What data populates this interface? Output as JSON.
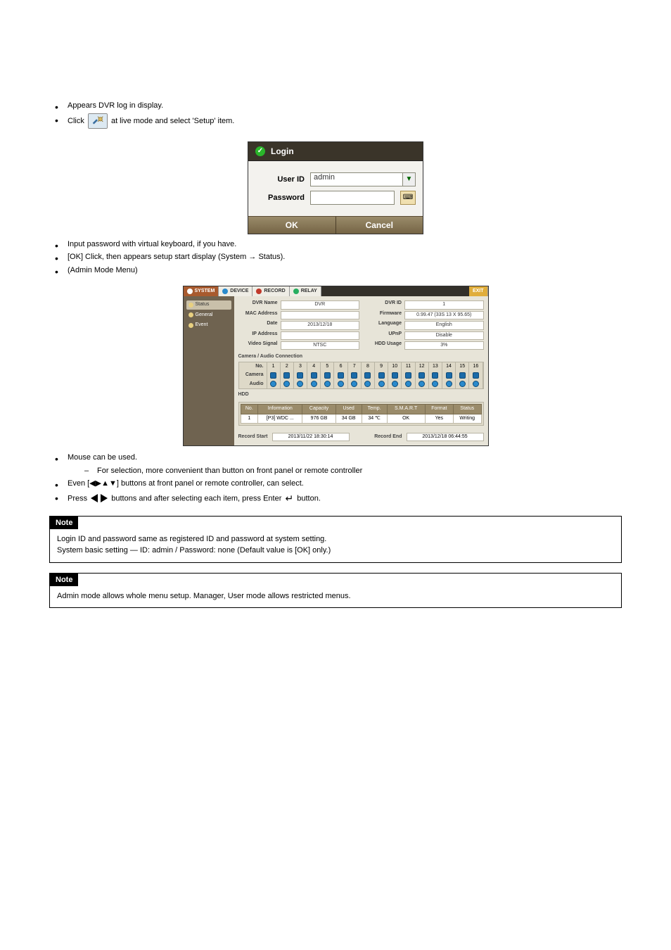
{
  "intro": {
    "line1": "Appears DVR log in display.",
    "line2_prefix": "Click ",
    "line2_suffix": " at live mode and select 'Setup' item."
  },
  "login_dialog": {
    "title": "Login",
    "user_label": "User ID",
    "user_value": "admin",
    "pass_label": "Password",
    "pass_value": "",
    "ok": "OK",
    "cancel": "Cancel"
  },
  "post_login": {
    "b1": "Input password with virtual keyboard, if you have.",
    "b2": "[OK] Click, then appears setup start display (System → Status).",
    "b3": "(Admin Mode Menu)"
  },
  "system_panel": {
    "tabs": {
      "system": "SYSTEM",
      "device": "DEVICE",
      "record": "RECORD",
      "relay": "RELAY",
      "exit": "EXIT"
    },
    "sidebar": [
      {
        "label": "Status",
        "active": true
      },
      {
        "label": "General",
        "active": false
      },
      {
        "label": "Event",
        "active": false
      }
    ],
    "info": {
      "dvr_name_label": "DVR Name",
      "dvr_name": "DVR",
      "dvr_id_label": "DVR ID",
      "dvr_id": "1",
      "mac_label": "MAC Address",
      "mac": "",
      "firmware_label": "Firmware",
      "firmware": "0.99.47 (33S 13 X 95.65)",
      "date_label": "Date",
      "date": "2013/12/18",
      "language_label": "Language",
      "language": "English",
      "ip_label": "IP Address",
      "ip": "",
      "upnp_label": "UPnP",
      "upnp": "Disable",
      "video_label": "Video Signal",
      "video": "NTSC",
      "hddusage_label": "HDD Usage",
      "hddusage": "3%"
    },
    "cam_section_title": "Camera / Audio Connection",
    "cam_labels": {
      "no": "No.",
      "camera": "Camera",
      "audio": "Audio"
    },
    "cam_numbers": [
      "1",
      "2",
      "3",
      "4",
      "5",
      "6",
      "7",
      "8",
      "9",
      "10",
      "11",
      "12",
      "13",
      "14",
      "15",
      "16"
    ],
    "hdd_title": "HDD",
    "hdd_headers": [
      "No.",
      "Information",
      "Capacity",
      "Used",
      "Temp.",
      "S.M.A.R.T",
      "Format",
      "Status"
    ],
    "hdd_row": [
      "1",
      "[P3] WDC ...",
      "976 GB",
      "34 GB",
      "34 ℃",
      "OK",
      "Yes",
      "Writing"
    ],
    "record_start_label": "Record Start",
    "record_start": "2013/11/22 18:30:14",
    "record_end_label": "Record End",
    "record_end": "2013/12/18 06:44:55"
  },
  "trailing": {
    "b1": "Mouse can be used.",
    "b1_sub": "For selection, more convenient than button on front panel or remote controller",
    "b2": "Even [◀▶▲▼] buttons at front panel or remote controller, can select.",
    "b3_prefix": "Press ",
    "b3_mid": " buttons and after selecting each item, press Enter ",
    "b3_suffix": " button.",
    "arrows_label": "[◀▶]"
  },
  "notes": {
    "tag": "Note",
    "note1_l1": "Login ID and password same as registered ID and password at system setting.",
    "note1_l2": "System basic setting — ID: admin / Password: none (Default value is [OK] only.)",
    "note2": "Admin mode allows whole menu setup. Manager, User mode allows restricted menus."
  }
}
